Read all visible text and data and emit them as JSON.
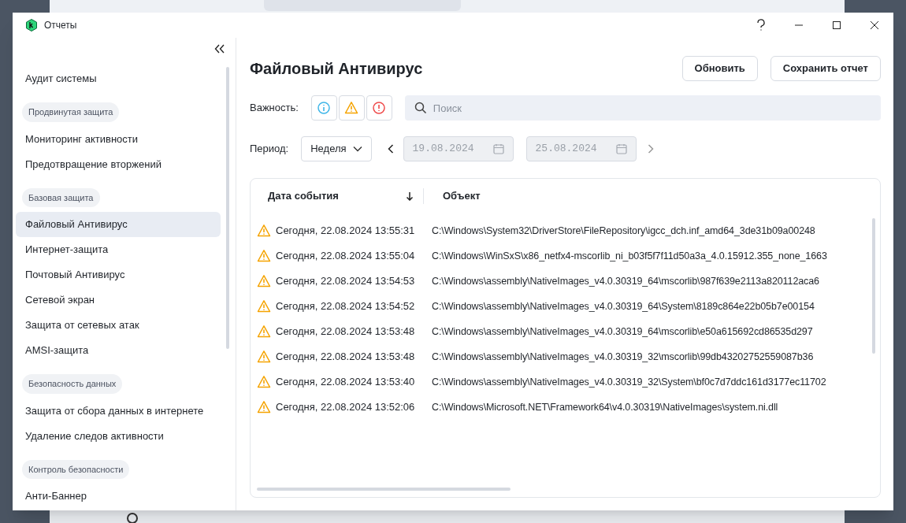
{
  "window": {
    "title": "Отчеты"
  },
  "sidebar": {
    "sections": [
      {
        "items": [
          {
            "label": "Аудит системы",
            "selected": false
          }
        ]
      },
      {
        "heading": "Продвинутая защита",
        "items": [
          {
            "label": "Мониторинг активности",
            "selected": false
          },
          {
            "label": "Предотвращение вторжений",
            "selected": false
          }
        ]
      },
      {
        "heading": "Базовая защита",
        "items": [
          {
            "label": "Файловый Антивирус",
            "selected": true
          },
          {
            "label": "Интернет-защита",
            "selected": false
          },
          {
            "label": "Почтовый Антивирус",
            "selected": false
          },
          {
            "label": "Сетевой экран",
            "selected": false
          },
          {
            "label": "Защита от сетевых атак",
            "selected": false
          },
          {
            "label": "AMSI-защита",
            "selected": false
          }
        ]
      },
      {
        "heading": "Безопасность данных",
        "items": [
          {
            "label": "Защита от сбора данных в интернете",
            "selected": false
          },
          {
            "label": "Удаление следов активности",
            "selected": false
          }
        ]
      },
      {
        "heading": "Контроль безопасности",
        "items": [
          {
            "label": "Анти-Баннер",
            "selected": false
          }
        ]
      }
    ]
  },
  "main": {
    "title": "Файловый Антивирус",
    "buttons": [
      "Обновить",
      "Сохранить отчет"
    ],
    "severity_label": "Важность:",
    "severity_filters": [
      {
        "kind": "info"
      },
      {
        "kind": "warning"
      },
      {
        "kind": "error"
      }
    ],
    "search": {
      "placeholder": "Поиск"
    },
    "period_label": "Период:",
    "period": "Неделя",
    "date_from": {
      "value": "19.08.2024",
      "disabled": true
    },
    "date_to": {
      "value": "25.08.2024",
      "disabled": true
    },
    "table": {
      "columns": [
        {
          "label": "Дата события"
        },
        {
          "label": "Объект"
        }
      ],
      "rows": [
        {
          "date": "Сегодня, 22.08.2024 13:55:31",
          "object": "C:\\Windows\\System32\\DriverStore\\FileRepository\\igcc_dch.inf_amd64_3de31b09a00248"
        },
        {
          "date": "Сегодня, 22.08.2024 13:55:04",
          "object": "C:\\Windows\\WinSxS\\x86_netfx4-mscorlib_ni_b03f5f7f11d50a3a_4.0.15912.355_none_1663"
        },
        {
          "date": "Сегодня, 22.08.2024 13:54:53",
          "object": "C:\\Windows\\assembly\\NativeImages_v4.0.30319_64\\mscorlib\\987f639e2113a820112aca6"
        },
        {
          "date": "Сегодня, 22.08.2024 13:54:52",
          "object": "C:\\Windows\\assembly\\NativeImages_v4.0.30319_64\\System\\8189c864e22b05b7e00154"
        },
        {
          "date": "Сегодня, 22.08.2024 13:53:48",
          "object": "C:\\Windows\\assembly\\NativeImages_v4.0.30319_64\\mscorlib\\e50a615692cd86535d297"
        },
        {
          "date": "Сегодня, 22.08.2024 13:53:48",
          "object": "C:\\Windows\\assembly\\NativeImages_v4.0.30319_32\\mscorlib\\99db43202752559087b36"
        },
        {
          "date": "Сегодня, 22.08.2024 13:53:40",
          "object": "C:\\Windows\\assembly\\NativeImages_v4.0.30319_32\\System\\bf0c7d7ddc161d3177ec11702"
        },
        {
          "date": "Сегодня, 22.08.2024 13:52:06",
          "object": "C:\\Windows\\Microsoft.NET\\Framework64\\v4.0.30319\\NativeImages\\system.ni.dll"
        }
      ]
    }
  }
}
